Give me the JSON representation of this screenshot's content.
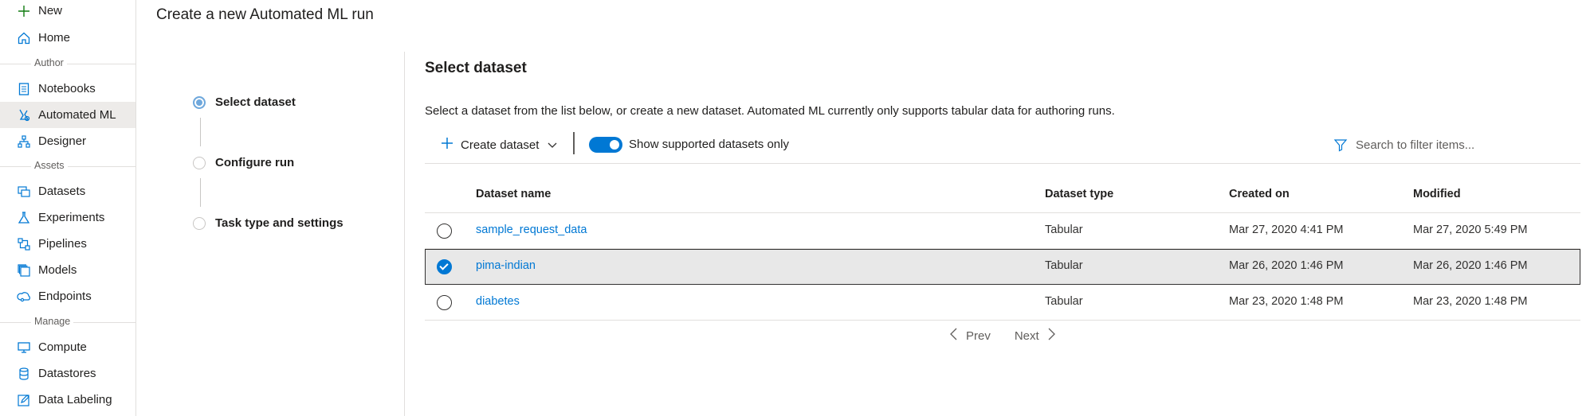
{
  "sidebar": {
    "new_label": "New",
    "home_label": "Home",
    "section_author": "Author",
    "notebooks_label": "Notebooks",
    "automl_label": "Automated ML",
    "designer_label": "Designer",
    "section_assets": "Assets",
    "datasets_label": "Datasets",
    "experiments_label": "Experiments",
    "pipelines_label": "Pipelines",
    "models_label": "Models",
    "endpoints_label": "Endpoints",
    "section_manage": "Manage",
    "compute_label": "Compute",
    "datastores_label": "Datastores",
    "data_labeling_label": "Data Labeling",
    "active_item": "Automated ML"
  },
  "page": {
    "title": "Create a new Automated ML run"
  },
  "wizard": {
    "steps": [
      {
        "label": "Select dataset",
        "active": true
      },
      {
        "label": "Configure run",
        "active": false
      },
      {
        "label": "Task type and settings",
        "active": false
      }
    ]
  },
  "main": {
    "section_title": "Select dataset",
    "description": "Select a dataset from the list below, or create a new dataset. Automated ML currently only supports tabular data for authoring runs.",
    "toolbar": {
      "create_label": "Create dataset",
      "toggle_label": "Show supported datasets only",
      "toggle_on": true,
      "search_placeholder": "Search to filter items..."
    },
    "table": {
      "columns": [
        "Dataset name",
        "Dataset type",
        "Created on",
        "Modified"
      ],
      "rows": [
        {
          "name": "sample_request_data",
          "type": "Tabular",
          "created": "Mar 27, 2020 4:41 PM",
          "modified": "Mar 27, 2020 5:49 PM",
          "selected": false
        },
        {
          "name": "pima-indian",
          "type": "Tabular",
          "created": "Mar 26, 2020 1:46 PM",
          "modified": "Mar 26, 2020 1:46 PM",
          "selected": true
        },
        {
          "name": "diabetes",
          "type": "Tabular",
          "created": "Mar 23, 2020 1:48 PM",
          "modified": "Mar 23, 2020 1:48 PM",
          "selected": false
        }
      ]
    },
    "pager": {
      "prev_label": "Prev",
      "next_label": "Next"
    }
  },
  "colors": {
    "accent": "#0078d4",
    "selected_row": "#e8e8e8",
    "step_active": "#6fa8dc"
  }
}
